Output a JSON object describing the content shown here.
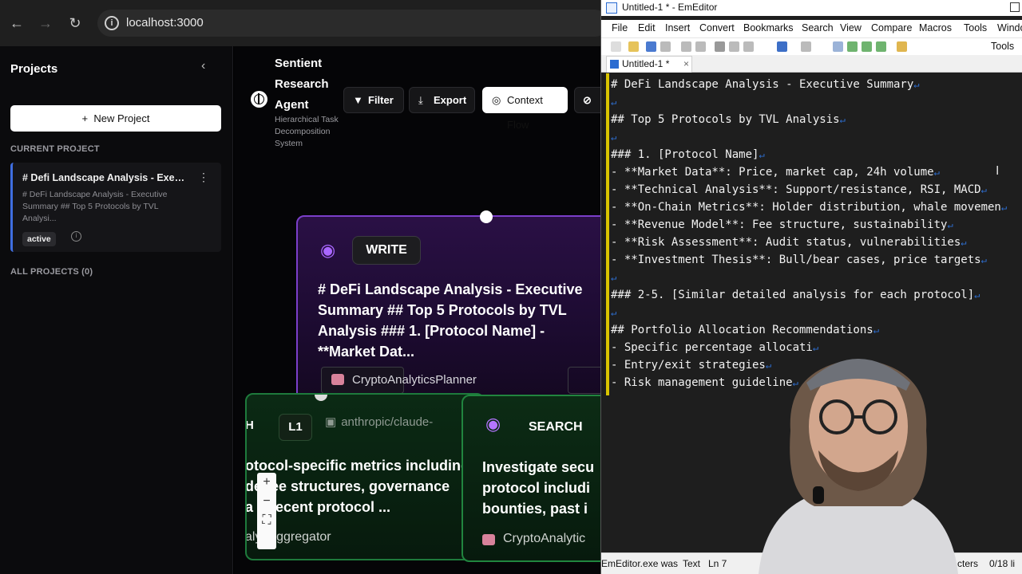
{
  "browser": {
    "back_icon": "arrow-left-icon",
    "forward_icon": "arrow-right-icon",
    "reload_icon": "reload-icon",
    "url": "localhost:3000"
  },
  "sidebar": {
    "title": "Projects",
    "collapse_icon": "chevron-left-icon",
    "new_project_label": "New Project",
    "current_project_label": "CURRENT PROJECT",
    "all_projects_label": "ALL PROJECTS (0)",
    "project": {
      "name": "# Defi Landscape Analysis - Executi...",
      "description": "# DeFi Landscape Analysis - Executive Summary ## Top 5 Protocols by TVL Analysi...",
      "status": "active"
    }
  },
  "app": {
    "name": "Sentient Research Agent",
    "tagline": "Hierarchical Task Decomposition System",
    "toolbar": {
      "filter": "Filter",
      "export": "Export",
      "context_flow": "Context Flow"
    }
  },
  "flow": {
    "write_node": {
      "type": "WRITE",
      "title": "# DeFi Landscape Analysis - Executive Summary ## Top 5 Protocols by TVL Analysis ### 1. [Protocol Name] - **Market Dat...",
      "agent": "CryptoAnalyticsPlanner"
    },
    "left_node": {
      "type": "H",
      "level": "L1",
      "model": "anthropic/claude-",
      "text_lines": [
        "otocol-specific metrics including",
        "de fee structures, governance",
        "a d recent protocol ..."
      ],
      "agent": "alysAggregator"
    },
    "right_node": {
      "type": "SEARCH",
      "text_lines": [
        "Investigate secu",
        "protocol includi",
        "bounties, past i"
      ],
      "agent": "CryptoAnalytic"
    },
    "zoom": {
      "in": "+",
      "out": "−",
      "fit": "⛶"
    }
  },
  "editor": {
    "title": "Untitled-1 * - EmEditor",
    "menu": [
      "File",
      "Edit",
      "Insert",
      "Convert",
      "Bookmarks",
      "Search",
      "View",
      "Compare",
      "Macros",
      "Tools",
      "Windo"
    ],
    "toolbar_tools": "Tools",
    "tab": "Untitled-1 *",
    "lines": [
      "# DeFi Landscape Analysis - Executive Summary",
      "",
      "## Top 5 Protocols by TVL Analysis",
      "",
      "### 1. [Protocol Name]",
      "- **Market Data**: Price, market cap, 24h volume",
      "- **Technical Analysis**: Support/resistance, RSI, MACD",
      "- **On-Chain Metrics**: Holder distribution, whale movemen",
      "- **Revenue Model**: Fee structure, sustainability",
      "- **Risk Assessment**: Audit status, vulnerabilities",
      "- **Investment Thesis**: Bull/bear cases, price targets",
      "",
      "### 2-5. [Similar detailed analysis for each protocol]",
      "",
      "## Portfolio Allocation Recommendations",
      "- Specific percentage allocati",
      "- Entry/exit strategies",
      "- Risk management guideline"
    ],
    "status": {
      "message": "EmEditor.exe was",
      "mode": "Text",
      "position": "Ln 7",
      "chars": "cters",
      "count": "0/18 li"
    }
  }
}
